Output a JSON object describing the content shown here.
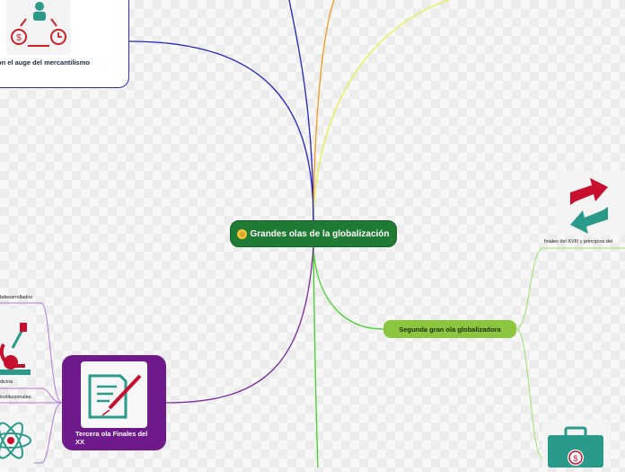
{
  "central_topic": {
    "icon": "smiley-icon",
    "label": "Grandes olas de la globalización"
  },
  "first_wave": {
    "label_line1": "on el auge del mercantilismo",
    "label_line2": ")",
    "border_color": "#2a2ad0",
    "icon": "money-cycle-icon"
  },
  "second_wave": {
    "label": "Segunda gran ola globalizadora",
    "color": "#8cc63f",
    "subtopic_label": "finales del XVIII y principios del ",
    "icons": [
      "arrows-icon",
      "briefcase-icon"
    ]
  },
  "third_wave": {
    "label": "Tercera ola Finales del XX",
    "color": "#6e1a8a",
    "icon": "document-pen-icon",
    "subtopics": [
      {
        "label": "bdesarrollados"
      },
      {
        "label": "dicina"
      },
      {
        "label": "institucionales"
      }
    ],
    "icons": [
      "lab-flask-icon",
      "atom-icon"
    ]
  },
  "branch_colors": {
    "blue": "#2323c8",
    "orange": "#f39a1e",
    "yellow": "#e8ee4a",
    "green": "#43d12b",
    "light_green": "#9be26e",
    "purple": "#7a2aa0",
    "light_purple": "#b07ad6"
  }
}
